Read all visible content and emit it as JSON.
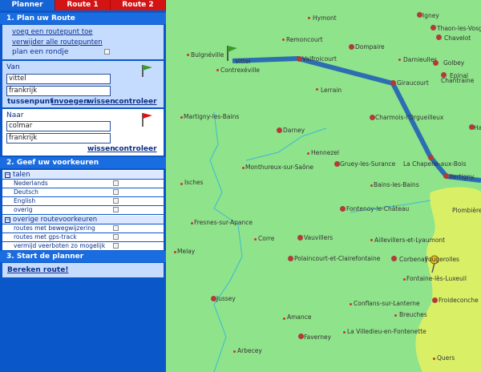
{
  "tabs": [
    "Planner",
    "Route 1",
    "Route 2"
  ],
  "section1": {
    "title": "1. Plan uw Route",
    "add_link": "voeg een routepunt toe",
    "remove_link": "verwijder alle routepunten",
    "round_trip": "plan een rondje"
  },
  "from": {
    "label": "Van",
    "city": "vittel",
    "country": "frankrijk",
    "waypoint_label": "tussenpunt",
    "insert": "invoegen",
    "clear": "wissen",
    "check": "controleer"
  },
  "to": {
    "label": "Naar",
    "city": "colmar",
    "country": "frankrijk",
    "clear": "wissen",
    "check": "controleer"
  },
  "section2": {
    "title": "2. Geef uw voorkeuren",
    "languages_header": "talen",
    "languages": [
      "Nederlands",
      "Deutsch",
      "English",
      "overig"
    ],
    "other_header": "overige routevoorkeuren",
    "other": [
      "routes met bewegwijzering",
      "routes met gps-track",
      "vermijd veerboten zo mogelijk"
    ]
  },
  "section3": {
    "title": "3. Start de planner",
    "calc": "Bereken route!"
  },
  "map": {
    "towns": [
      "Hymont",
      "Igney",
      "Thaon-les-Vosges",
      "Chavelot",
      "Remoncourt",
      "Dompaire",
      "Bulgnéville",
      "Vittel",
      "Valfroicourt",
      "Darnieulles",
      "Golbey",
      "Contrexéville",
      "Epinal",
      "Chantraine",
      "Giraucourt",
      "Lerrain",
      "Charmois-l'Orgueilleux",
      "Hadol",
      "Martigny-les-Bains",
      "Darney",
      "Hennezel",
      "Gruey-les-Surance",
      "La Chapelle-aux-Bois",
      "Xertigny",
      "Monthureux-sur-Saône",
      "Isches",
      "Bains-les-Bains",
      "Plombières",
      "Fontenoy-le-Château",
      "Fresnes-sur-Apance",
      "Corre",
      "Vauvillers",
      "Aillevillers-et-Lyaumont",
      "Melay",
      "Polaincourt-et-Clairefontaine",
      "Corbenay",
      "Fougerolles",
      "Fontaine-lès-Luxeuil",
      "Jussey",
      "Froideconche",
      "Conflans-sur-Lanterne",
      "Amance",
      "Breuches",
      "La Villedieu-en-Fontenette",
      "Faverney",
      "Arbecey",
      "Quers"
    ]
  }
}
